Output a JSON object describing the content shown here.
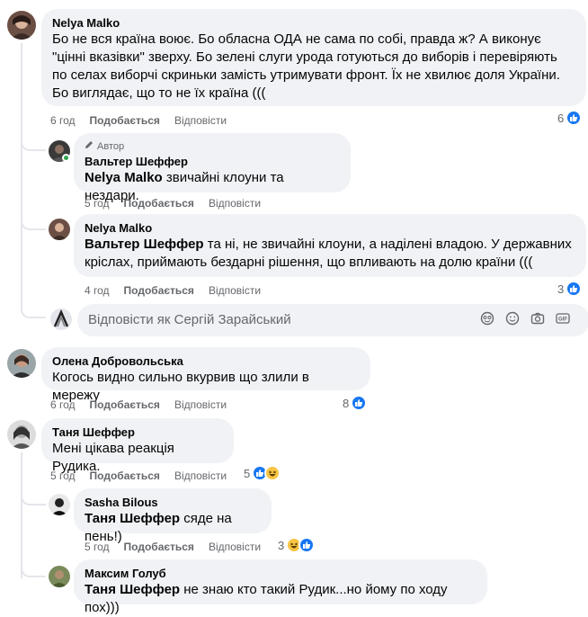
{
  "colors": {
    "like_blue": "#1877f2",
    "bubble_bg": "#f0f2f5",
    "meta_gray": "#65676b",
    "online_green": "#31a24c"
  },
  "comments": [
    {
      "author": "Nelya Malko",
      "text": "Бо не вся країна воює. Бо обласна ОДА не сама по собі, правда ж? А виконує \"цінні вказівки\" зверху. Бо зелені слуги урода готуються до виборів і перевіряють по селах виборчі скриньки замість утримувати фронт. Їх не хвилює доля України. Бо виглядає, що то не їх країна (((",
      "time": "6 год",
      "like": "Подобається",
      "reply": "Відповісти",
      "reactions": "6",
      "reaction_icons": [
        "like-icon"
      ]
    }
  ],
  "replies1": [
    {
      "badge": "Автор",
      "author": "Вальтер Шеффер",
      "mention": "Nelya Malko",
      "text": " звичайні клоуни та нездари.",
      "time": "5 год",
      "like": "Подобається",
      "reply": "Відповісти"
    },
    {
      "author": "Nelya Malko",
      "mention": "Вальтер Шеффер",
      "text": " та ні, не звичайні клоуни, а наділені владою. У державних кріслах, приймають бездарні рішення, що впливають на долю країни (((",
      "time": "4 год",
      "like": "Подобається",
      "reply": "Відповісти",
      "reactions": "3",
      "reaction_icons": [
        "like-icon"
      ]
    }
  ],
  "reply_box": {
    "placeholder": "Відповісти як Сергій Зарайський",
    "icons": [
      "sticker-icon",
      "emoji-icon",
      "camera-icon",
      "gif-icon"
    ]
  },
  "comment2": {
    "author": "Олена Добровольська",
    "text": "Когось видно сильно вкурвив що злили в мережу",
    "time": "6 год",
    "like": "Подобається",
    "reply": "Відповісти",
    "reactions": "8",
    "reaction_icons": [
      "like-icon"
    ]
  },
  "comment3": {
    "author": "Таня Шеффер",
    "text": "Мені цікава реакція Рудика.",
    "time": "5 год",
    "like": "Подобається",
    "reply": "Відповісти",
    "reactions": "5",
    "reaction_icons": [
      "like-icon",
      "haha-icon"
    ]
  },
  "replies3": [
    {
      "author": "Sasha Bilous",
      "mention": "Таня Шеффер",
      "text": " сяде на пень!)",
      "time": "5 год",
      "like": "Подобається",
      "reply": "Відповісти",
      "reactions": "3",
      "reaction_icons": [
        "haha-icon",
        "like-icon"
      ]
    },
    {
      "author": "Максим Голуб",
      "mention": "Таня Шеффер",
      "text": " не знаю кто такий Рудик...но йому по ходу пох)))"
    }
  ]
}
